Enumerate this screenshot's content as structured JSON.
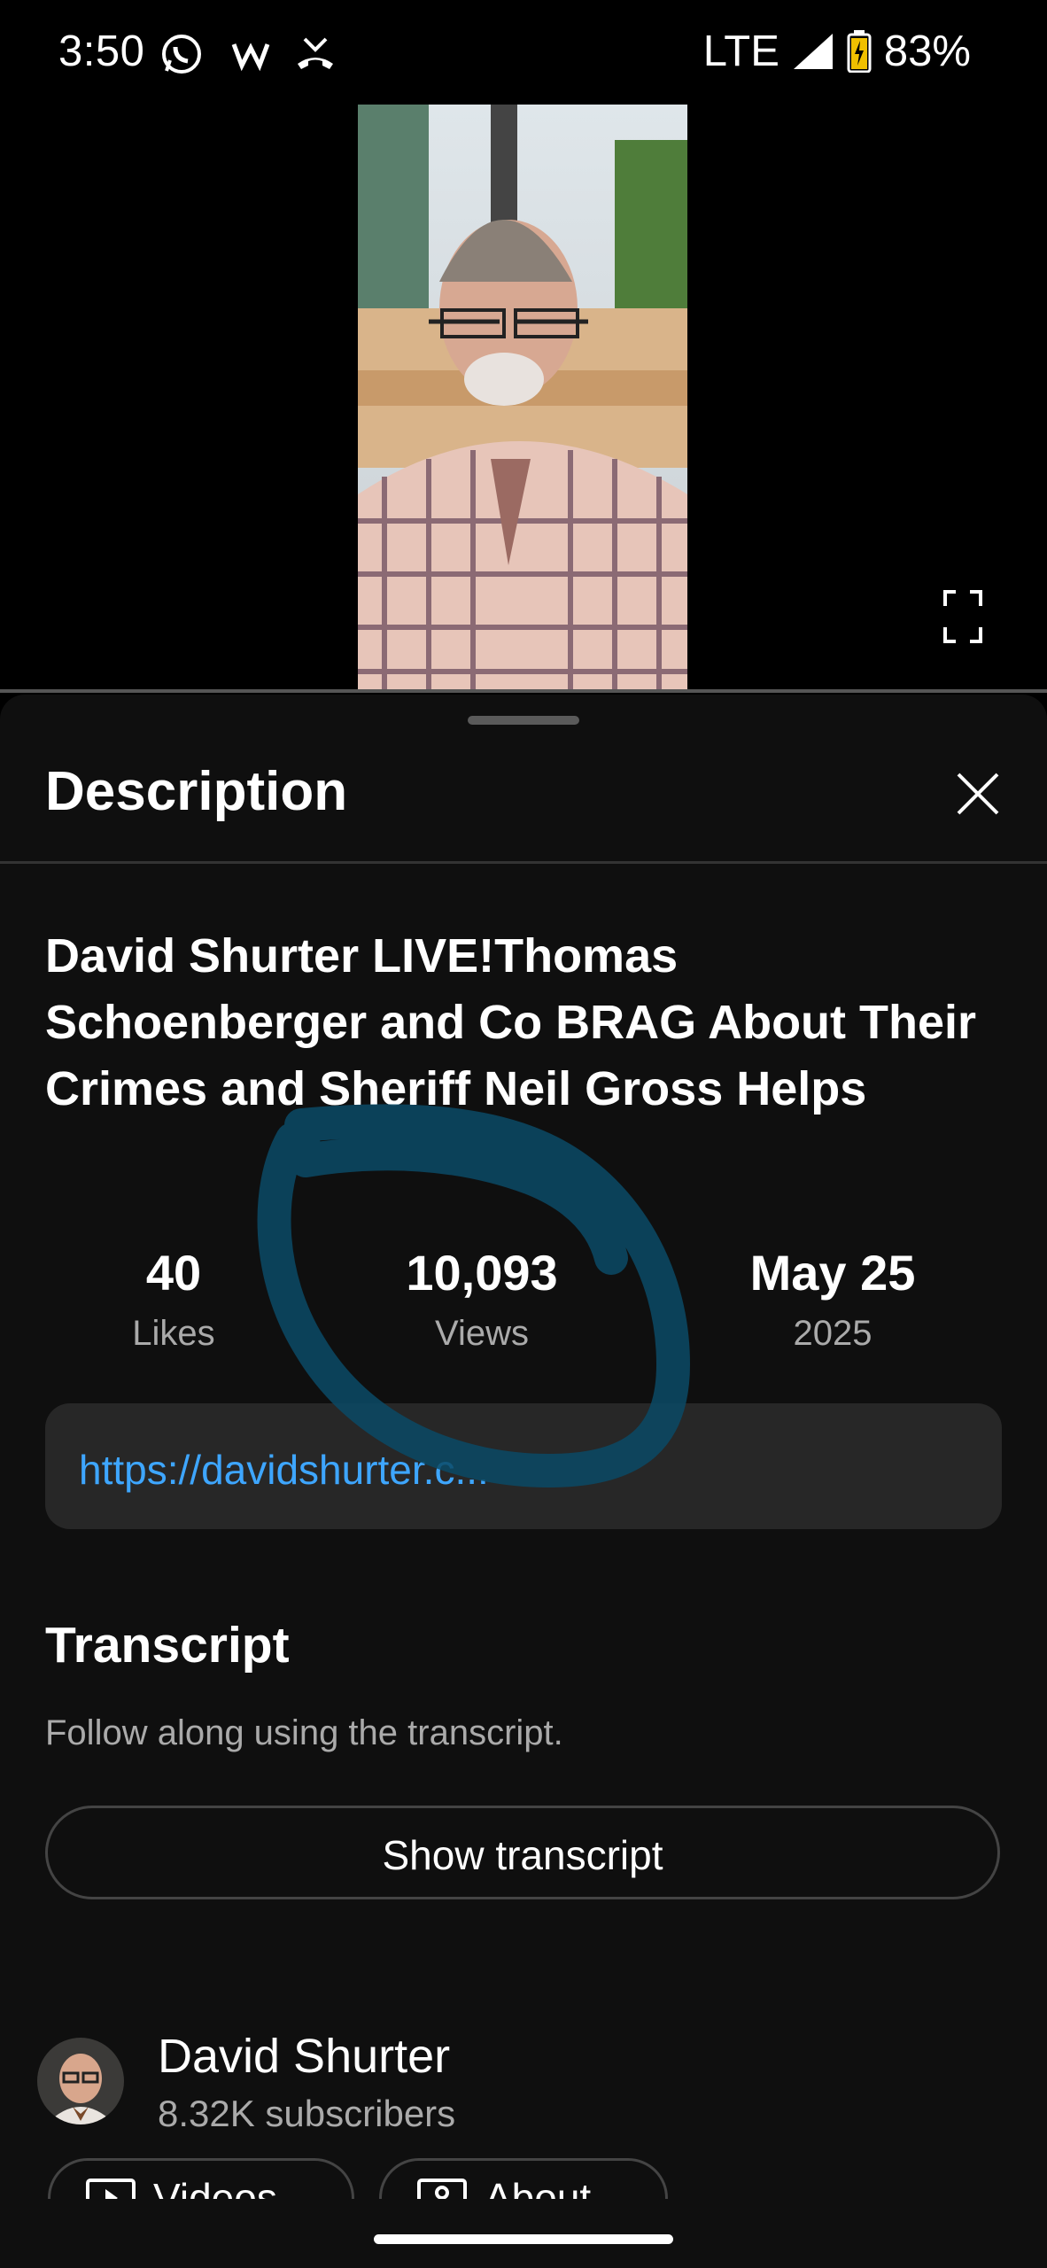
{
  "status_bar": {
    "time": "3:50",
    "network": "LTE",
    "battery": "83%",
    "icons": [
      "whatsapp-icon",
      "w-icon",
      "missed-call-icon",
      "signal-icon",
      "battery-icon"
    ]
  },
  "video": {
    "progress_percent": 0
  },
  "sheet": {
    "title": "Description",
    "close_icon": "close-icon"
  },
  "description": {
    "video_title": "David Shurter LIVE!Thomas Schoenberger and Co BRAG About Their Crimes and Sheriff Neil Gross Helps",
    "stats": {
      "likes_value": "40",
      "likes_label": "Likes",
      "views_value": "10,093",
      "views_label": "Views",
      "date_value": "May 25",
      "date_year": "2025"
    },
    "link": "https://davidshurter.c..."
  },
  "transcript": {
    "title": "Transcript",
    "subtitle": "Follow along using the transcript.",
    "button": "Show transcript"
  },
  "channel": {
    "name": "David Shurter",
    "subscribers": "8.32K subscribers",
    "chips": [
      "Videos",
      "About"
    ]
  },
  "colors": {
    "link": "#3ea6ff",
    "sheet_bg": "#0f0f0f",
    "scribble": "#0b4a66"
  }
}
